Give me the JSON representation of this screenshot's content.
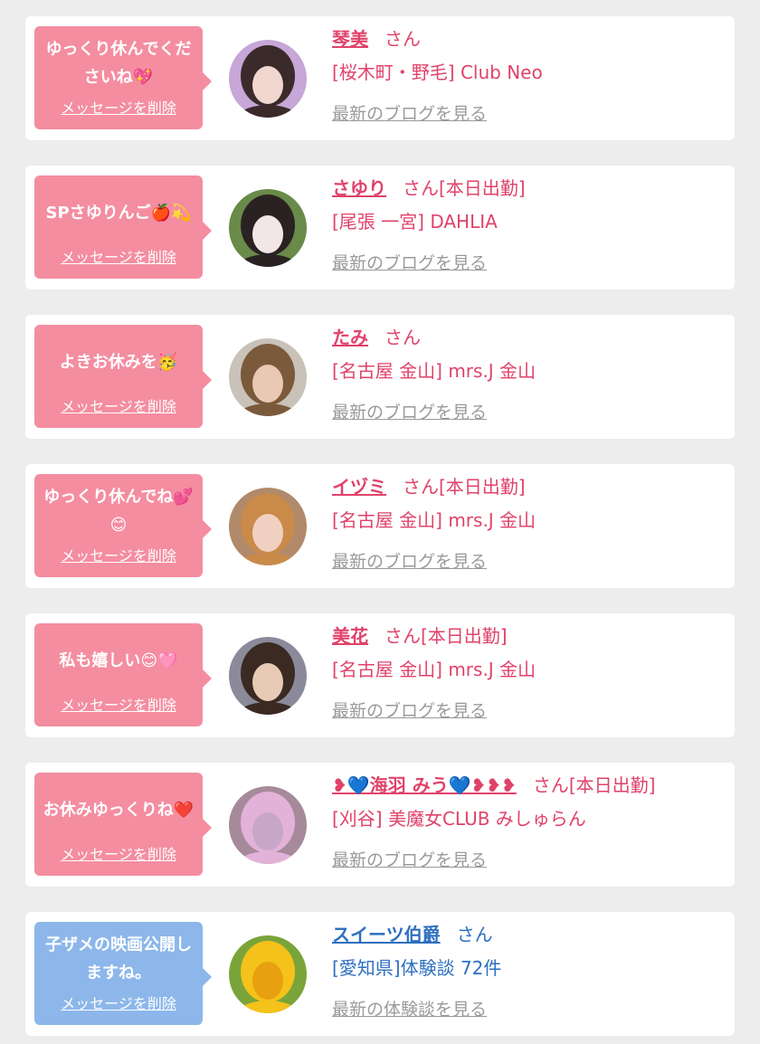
{
  "delete_label": "メッセージを削除",
  "items": [
    {
      "message": "ゆっくり休んでくださいね💖",
      "name": "琴美",
      "suffix": "さん",
      "badge": "",
      "shop": "[桜木町・野毛] Club Neo",
      "blog_link": "最新のブログを見る",
      "theme": "pink"
    },
    {
      "message": "SPさゆりんご🍎💫",
      "name": "さゆり",
      "suffix": "さん",
      "badge": "[本日出勤]",
      "shop": "[尾張 一宮] DAHLIA",
      "blog_link": "最新のブログを見る",
      "theme": "pink"
    },
    {
      "message": "よきお休みを🥳",
      "name": "たみ",
      "suffix": "さん",
      "badge": "",
      "shop": "[名古屋 金山] mrs.J 金山",
      "blog_link": "最新のブログを見る",
      "theme": "pink"
    },
    {
      "message": "ゆっくり休んでね💕😊",
      "name": "イヅミ",
      "suffix": "さん",
      "badge": "[本日出勤]",
      "shop": "[名古屋 金山] mrs.J 金山",
      "blog_link": "最新のブログを見る",
      "theme": "pink"
    },
    {
      "message": "私も嬉しい😊🩷",
      "name": "美花",
      "suffix": "さん",
      "badge": "[本日出勤]",
      "shop": "[名古屋 金山] mrs.J 金山",
      "blog_link": "最新のブログを見る",
      "theme": "pink"
    },
    {
      "message": "お休みゆっくりね❤️",
      "name": "❥💙海羽 みう💙❥❥❥",
      "suffix": "さん",
      "badge": "[本日出勤]",
      "shop": "[刈谷] 美魔女CLUB みしゅらん",
      "blog_link": "最新のブログを見る",
      "theme": "pink"
    },
    {
      "message": "子ザメの映画公開しますね。",
      "name": "スイーツ伯爵",
      "suffix": "さん",
      "badge": "",
      "shop": "[愛知県]体験談 72件",
      "blog_link": "最新の体験談を見る",
      "theme": "blue"
    }
  ],
  "avatar_colors": [
    [
      "#c7a6d8",
      "#3a2a2a",
      "#f1d7cf"
    ],
    [
      "#6a8a4a",
      "#2a2222",
      "#f2e6e6"
    ],
    [
      "#c9c2b8",
      "#7a5a3a",
      "#e9c9b5"
    ],
    [
      "#b08a6a",
      "#c98a4a",
      "#f0d0c0"
    ],
    [
      "#8a8a9a",
      "#3a2a22",
      "#e7cbb7"
    ],
    [
      "#a68a9a",
      "#e3b2d8",
      "#c8a6c8"
    ],
    [
      "#7aa43a",
      "#f4c21a",
      "#e8a010"
    ]
  ]
}
